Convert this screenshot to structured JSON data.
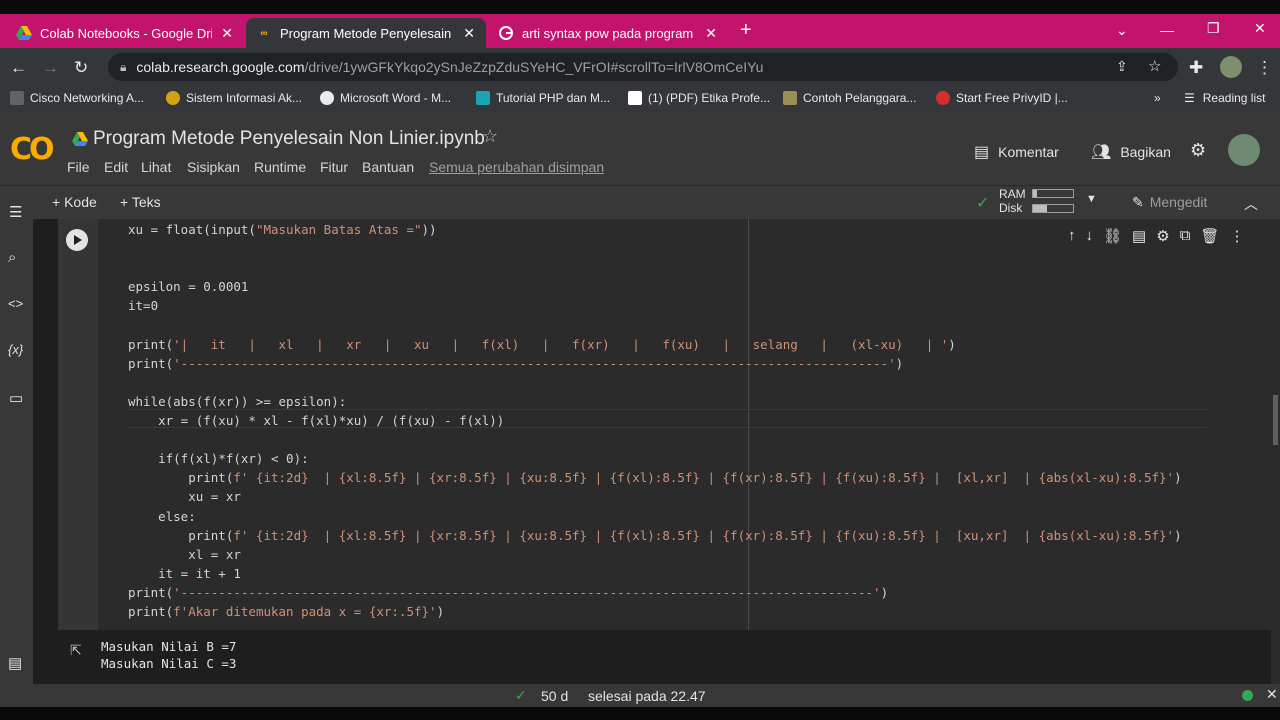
{
  "browser": {
    "tabs": [
      {
        "title": "Colab Notebooks - Google Drive",
        "close": "✕"
      },
      {
        "title": "Program Metode Penyelesain No",
        "close": "✕"
      },
      {
        "title": "arti syntax pow pada program pl",
        "close": "✕"
      }
    ],
    "new_tab": "+",
    "url_host": "colab.research.google.com",
    "url_path": "/drive/1ywGFkYkqo2ySnJeZzpZduSYeHC_VFrOI#scrollTo=IrlV8OmCeIYu",
    "bookmarks": [
      "Cisco Networking A...",
      "Sistem Informasi Ak...",
      "Microsoft Word - M...",
      "Tutorial PHP dan M...",
      "(1) (PDF) Etika Profe...",
      "Contoh Pelanggara...",
      "Start Free PrivyID |..."
    ],
    "bookmarks_more": "»",
    "reading_list": "Reading list"
  },
  "colab": {
    "logo": "CO",
    "title": "Program Metode Penyelesain Non Linier.ipynb",
    "menu": [
      "File",
      "Edit",
      "Lihat",
      "Sisipkan",
      "Runtime",
      "Fitur",
      "Bantuan"
    ],
    "saved_status": "Semua perubahan disimpan",
    "comment_label": "Komentar",
    "share_label": "Bagikan",
    "add_code": "+ Kode",
    "add_text": "+ Teks",
    "ram_label": "RAM",
    "disk_label": "Disk",
    "ram_usage": 0.1,
    "disk_usage": 0.35,
    "editing_label": "Mengedit"
  },
  "code_lines": [
    "xu = float(input(\"Masukan Batas Atas =\"))",
    "",
    "",
    "epsilon = 0.0001",
    "it=0",
    "",
    "print('|   it   |   xl   |   xr   |   xu   |   f(xl)   |   f(xr)   |   f(xu)   |   selang   |   (xl-xu)   | ')",
    "print('----------------------------------------------------------------------------------------------')",
    "",
    "while(abs(f(xr)) >= epsilon):",
    "    xr = (f(xu) * xl - f(xl)*xu) / (f(xu) - f(xl))",
    "",
    "    if(f(xl)*f(xr) < 0):",
    "        print(f' {it:2d}  | {xl:8.5f} | {xr:8.5f} | {xu:8.5f} | {f(xl):8.5f} | {f(xr):8.5f} | {f(xu):8.5f} |  [xl,xr]  | {abs(xl-xu):8.5f}')",
    "        xu = xr",
    "    else:",
    "        print(f' {it:2d}  | {xl:8.5f} | {xr:8.5f} | {xu:8.5f} | {f(xl):8.5f} | {f(xr):8.5f} | {f(xu):8.5f} |  [xu,xr]  | {abs(xl-xu):8.5f}')",
    "        xl = xr",
    "    it = it + 1",
    "print('--------------------------------------------------------------------------------------------')",
    "print(f'Akar ditemukan pada x = {xr:.5f}')"
  ],
  "output_lines": "Masukan Nilai B =7\nMasukan Nilai C =3",
  "status": {
    "check": "✓",
    "duration": "50 d",
    "finished": "selesai pada 22.47"
  }
}
